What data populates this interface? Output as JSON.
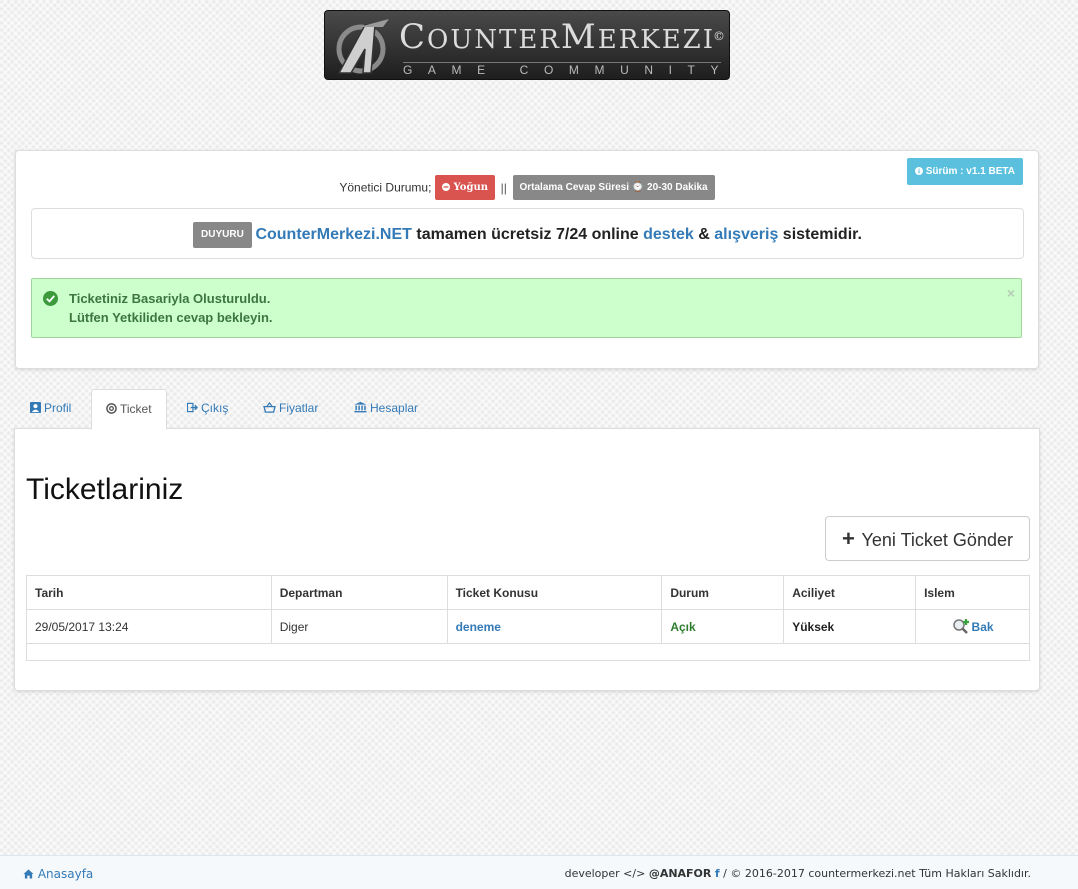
{
  "logo": {
    "main_c": "C",
    "main_rest1": "OUNTER",
    "main_m": "M",
    "main_rest2": "ERKEZI",
    "copyright": "©",
    "sub": "GAME COMMUNITY"
  },
  "status": {
    "version": "Sürüm : v1.1 BETA",
    "admin_label": "Yönetici Durumu;",
    "admin_state": "Yoğun",
    "separator": "||",
    "response_time": "Ortalama Cevap Süresi ⌚ 20-30 Dakika"
  },
  "announcement": {
    "tag": "DUYURU",
    "site": "CounterMerkezi.NET",
    "text1": " tamamen ücretsiz 7/24 online ",
    "link1": "destek",
    "text2": " & ",
    "link2": "alışveriş",
    "text3": " sistemidir."
  },
  "alert": {
    "line1": "Ticketiniz Basariyla Olusturuldu.",
    "line2": "Lütfen Yetkiliden cevap bekleyin.",
    "close": "×",
    "color": "#ccffcc"
  },
  "tabs": [
    {
      "label": "Profil",
      "icon": "user-icon"
    },
    {
      "label": "Ticket",
      "icon": "lifebuoy-icon",
      "active": true
    },
    {
      "label": "Çıkış",
      "icon": "sign-out-icon"
    },
    {
      "label": "Fiyatlar",
      "icon": "basket-icon"
    },
    {
      "label": "Hesaplar",
      "icon": "bank-icon"
    }
  ],
  "main": {
    "title": "Ticketlariniz",
    "new_ticket": "Yeni Ticket Gönder",
    "columns": [
      "Tarih",
      "Departman",
      "Ticket Konusu",
      "Durum",
      "Aciliyet",
      "Islem"
    ],
    "rows": [
      {
        "date": "29/05/2017 13:24",
        "department": "Diger",
        "subject": "deneme",
        "status": "Açık",
        "priority": "Yüksek",
        "action": "Bak"
      }
    ]
  },
  "footer": {
    "home": "Anasayfa",
    "dev_prefix": "developer </> ",
    "dev_name": "@ANAFOR",
    "fb": "f",
    "copyright": " / © 2016-2017 countermerkezi.net Tüm Hakları Saklıdır."
  }
}
